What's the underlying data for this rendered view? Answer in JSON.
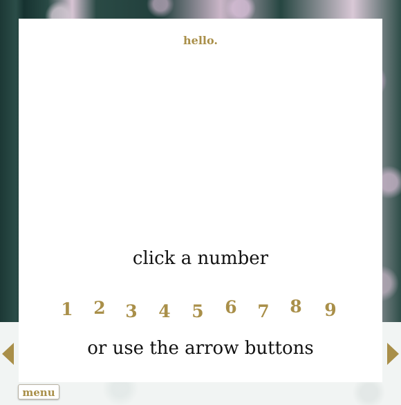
{
  "slide": {
    "greeting": "hello.",
    "instruction": "click a number",
    "alt_instruction": "or use the arrow buttons",
    "numbers": [
      "1",
      "2",
      "3",
      "4",
      "5",
      "6",
      "7",
      "8",
      "9"
    ]
  },
  "nav": {
    "menu_label": "menu",
    "prev_icon": "arrow-left-icon",
    "next_icon": "arrow-right-icon"
  },
  "colors": {
    "accent_gold": "#a98f49",
    "card_background": "#ffffff",
    "text_dark": "#111111"
  }
}
